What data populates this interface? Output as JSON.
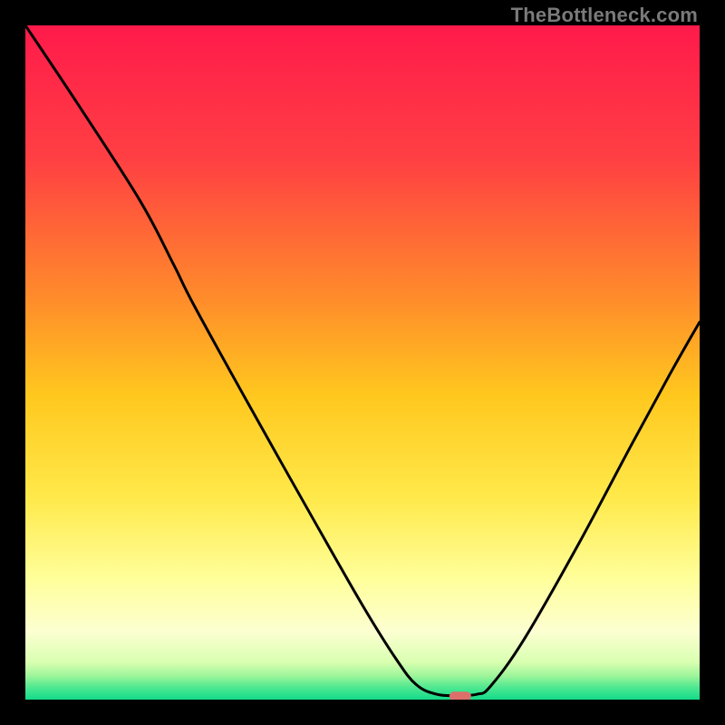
{
  "watermark": "TheBottleneck.com",
  "chart_data": {
    "type": "line",
    "title": "",
    "xlabel": "",
    "ylabel": "",
    "xlim": [
      0,
      100
    ],
    "ylim": [
      0,
      100
    ],
    "grid": false,
    "legend": false,
    "gradient_stops": [
      {
        "offset": 0.0,
        "color": "#ff1a4b"
      },
      {
        "offset": 0.2,
        "color": "#ff4043"
      },
      {
        "offset": 0.4,
        "color": "#ff8a2b"
      },
      {
        "offset": 0.55,
        "color": "#ffc81e"
      },
      {
        "offset": 0.7,
        "color": "#ffe94a"
      },
      {
        "offset": 0.82,
        "color": "#ffff9a"
      },
      {
        "offset": 0.9,
        "color": "#fcffd1"
      },
      {
        "offset": 0.945,
        "color": "#d8ffb0"
      },
      {
        "offset": 0.965,
        "color": "#9cf59a"
      },
      {
        "offset": 0.982,
        "color": "#4ee890"
      },
      {
        "offset": 1.0,
        "color": "#13db8a"
      }
    ],
    "curve_points": [
      {
        "x": 0.0,
        "y": 100.0
      },
      {
        "x": 8.0,
        "y": 88.0
      },
      {
        "x": 17.0,
        "y": 74.0
      },
      {
        "x": 22.0,
        "y": 64.5
      },
      {
        "x": 25.0,
        "y": 58.5
      },
      {
        "x": 33.0,
        "y": 44.0
      },
      {
        "x": 42.0,
        "y": 28.0
      },
      {
        "x": 50.0,
        "y": 14.0
      },
      {
        "x": 55.0,
        "y": 6.0
      },
      {
        "x": 58.0,
        "y": 2.2
      },
      {
        "x": 61.0,
        "y": 0.8
      },
      {
        "x": 64.0,
        "y": 0.6
      },
      {
        "x": 67.0,
        "y": 0.8
      },
      {
        "x": 69.0,
        "y": 2.0
      },
      {
        "x": 74.0,
        "y": 9.0
      },
      {
        "x": 82.0,
        "y": 23.0
      },
      {
        "x": 90.0,
        "y": 38.0
      },
      {
        "x": 96.0,
        "y": 49.0
      },
      {
        "x": 100.0,
        "y": 56.0
      }
    ],
    "marker": {
      "x": 64.5,
      "y": 0.5,
      "color": "#dd6f6a"
    }
  }
}
